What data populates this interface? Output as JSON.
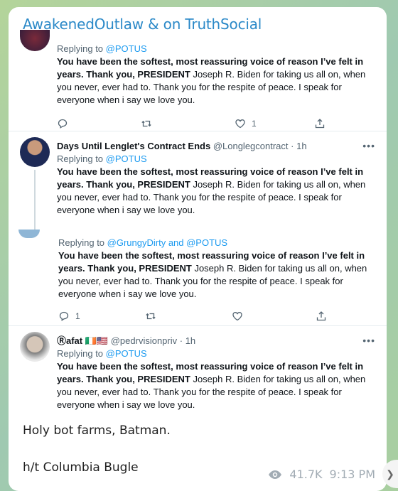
{
  "channel": {
    "title": "AwakenedOutlaw & on TruthSocial"
  },
  "tweets": [
    {
      "replying_prefix": "Replying to ",
      "replying_handle": "@POTUS",
      "bold_text": "You have been the softest, most reassuring voice of reason I’ve felt in years. Thank you, PRESIDENT",
      "rest_text": " Joseph R. Biden for taking us all on, when you never, ever had to. Thank you for the respite of peace. I speak for everyone when i say we love you.",
      "like_count": "1"
    },
    {
      "name": "Days Until Lenglet's Contract Ends",
      "handle": "@Longlegcontract",
      "time": "· 1h",
      "more": "•••",
      "replying_prefix": "Replying to ",
      "replying_handle": "@POTUS",
      "bold_text": "You have been the softest, most reassuring voice of reason I’ve felt in years. Thank you, PRESIDENT",
      "rest_text": " Joseph R. Biden for taking us all on, when you never, ever had to. Thank you for the respite of peace. I speak for everyone when i say we love you."
    },
    {
      "replying_prefix": "Replying to ",
      "replying_handle": "@GrungyDirty and @POTUS",
      "bold_text": "You have been the softest, most reassuring voice of reason I’ve felt in years. Thank you, PRESIDENT",
      "rest_text": " Joseph R. Biden for taking us all on, when you never, ever had to. Thank you for the respite of peace. I speak for everyone when i say we love you.",
      "reply_count": "1"
    },
    {
      "name": "Ⓡafat 🇮🇪🇺🇸",
      "handle": "@pedrvisionpriv",
      "time": "· 1h",
      "more": "•••",
      "replying_prefix": "Replying to ",
      "replying_handle": "@POTUS",
      "bold_text": "You have been the softest, most reassuring voice of reason I’ve felt in years. Thank you, PRESIDENT",
      "rest_text": " Joseph R. Biden for taking us all on, when you never, ever had to. Thank you for the respite of peace. I speak for everyone when i say we love you."
    }
  ],
  "message": {
    "line1": "Holy bot farms, Batman.",
    "line2": "h/t Columbia Bugle",
    "views": "41.7K",
    "time": "9:13 PM"
  },
  "icons": {
    "reply": "reply-icon",
    "retweet": "retweet-icon",
    "like": "heart-icon",
    "share": "share-icon",
    "views": "eye-icon",
    "forward": "forward-icon"
  },
  "colors": {
    "link": "#1d9bf0",
    "channel_title": "#2b89c8"
  }
}
